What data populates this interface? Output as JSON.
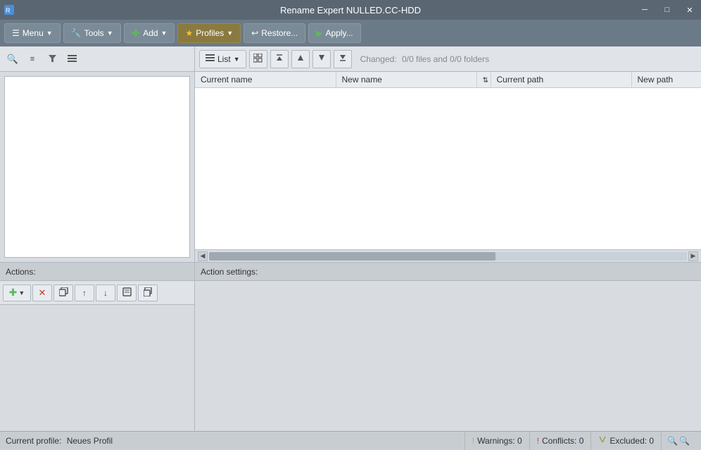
{
  "titleBar": {
    "title": "Rename Expert NULLED.CC-HDD",
    "controls": {
      "minimize": "─",
      "maximize": "□",
      "close": "✕"
    }
  },
  "toolbar": {
    "menu": "Menu",
    "tools": "Tools",
    "add": "Add",
    "profiles": "Profiles",
    "restore": "Restore...",
    "apply": "Apply..."
  },
  "leftPanel": {
    "actionsLabel": "Actions:",
    "actionSettingsLabel": "Action settings:"
  },
  "rightPanel": {
    "listLabel": "List",
    "changedLabel": "Changed:",
    "changedValue": "0/0 files and 0/0 folders",
    "columns": {
      "currentName": "Current name",
      "newName": "New name",
      "currentPath": "Current path",
      "newPath": "New path"
    }
  },
  "statusBar": {
    "profileLabel": "Current profile:",
    "profileName": "Neues Profil",
    "warnings": "Warnings: 0",
    "conflicts": "Conflicts: 0",
    "excluded": "Excluded: 0"
  },
  "icons": {
    "search": "🔍",
    "list": "☰",
    "filter": "▼",
    "lines": "≡",
    "up": "▲",
    "down": "▼",
    "left": "◀",
    "right": "▶",
    "grid": "⊞",
    "menu": "☰",
    "tools": "🔧",
    "add": "✚",
    "star": "★",
    "restore": "↩",
    "play": "▶",
    "arrow-up": "↑",
    "arrow-down": "↓",
    "delete": "✕",
    "copy": "⊡",
    "move-up": "↑",
    "move-down": "↓",
    "edit": "✏",
    "duplicate": "⊞",
    "warning": "!",
    "conflict": "!",
    "exclude": "Y"
  }
}
